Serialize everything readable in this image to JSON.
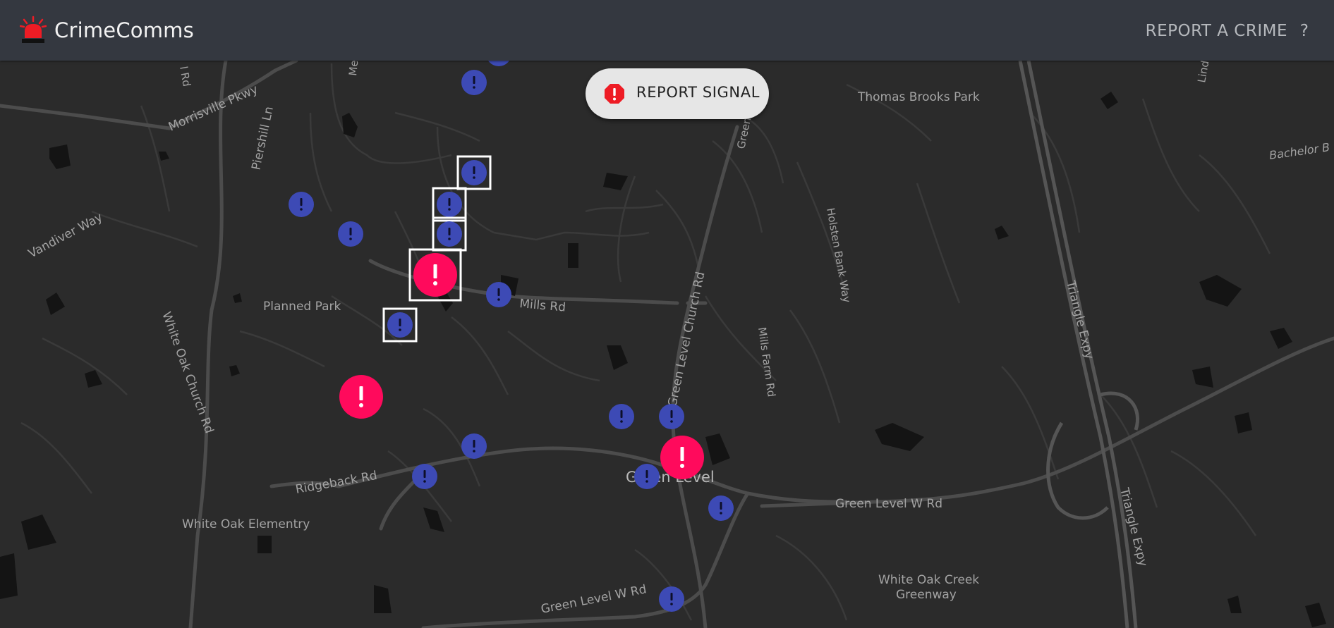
{
  "app": {
    "title": "CrimeComms",
    "logo_icon": "siren-icon"
  },
  "nav": {
    "report_crime": "REPORT A CRIME",
    "help": "?"
  },
  "report_signal": {
    "label": "REPORT SIGNAL",
    "icon": "alert-octagon-icon"
  },
  "colors": {
    "topbar": "#343840",
    "map_bg": "#2b2b2b",
    "major_marker": "#ff0a5c",
    "minor_marker": "#3d4ab5",
    "alert_icon": "#ee1c25"
  },
  "map": {
    "labels": {
      "morrisville_pkwy": "Morrisville Pkwy",
      "piershill_ln": "Piershill Ln",
      "vandiver_way": "Vandiver Way",
      "planned_park": "Planned Park",
      "mills_rd": "Mills Rd",
      "white_oak_church_rd": "White Oak Church Rd",
      "ridgeback_rd": "Ridgeback Rd",
      "white_oak_elementry": "White Oak Elementry",
      "thomas_brooks_park": "Thomas Brooks Park",
      "bachelor_b": "Bachelor B",
      "holsten_bank_way": "Holsten Bank Way",
      "green_level_church_rd": "Green Level Church Rd",
      "mills_farm_rd": "Mills Farm Rd",
      "green_level": "Green Level",
      "green_level_w_rd_east": "Green Level W Rd",
      "green_level_w_rd_south": "Green Level W Rd",
      "triangle_expy_north": "Triangle Expy",
      "triangle_expy_south": "Triangle Expy",
      "white_oak_creek_greenway_1": "White Oak Creek",
      "white_oak_creek_greenway_2": "Greenway",
      "green_partial": "Green",
      "lind_partial": "Lind",
      "rd_partial": "l Rd",
      "me_partial": "Me"
    },
    "markers": [
      {
        "type": "minor",
        "selected": false
      },
      {
        "type": "minor",
        "selected": false
      },
      {
        "type": "minor",
        "selected": true
      },
      {
        "type": "minor",
        "selected": false
      },
      {
        "type": "minor",
        "selected": true
      },
      {
        "type": "minor",
        "selected": false
      },
      {
        "type": "minor",
        "selected": true
      },
      {
        "type": "major",
        "selected": true
      },
      {
        "type": "minor",
        "selected": false
      },
      {
        "type": "minor",
        "selected": true
      },
      {
        "type": "major",
        "selected": false
      },
      {
        "type": "minor",
        "selected": false
      },
      {
        "type": "minor",
        "selected": false
      },
      {
        "type": "minor",
        "selected": false
      },
      {
        "type": "minor",
        "selected": false
      },
      {
        "type": "major",
        "selected": false
      },
      {
        "type": "minor",
        "selected": false
      },
      {
        "type": "minor",
        "selected": false
      },
      {
        "type": "minor",
        "selected": false
      }
    ]
  }
}
